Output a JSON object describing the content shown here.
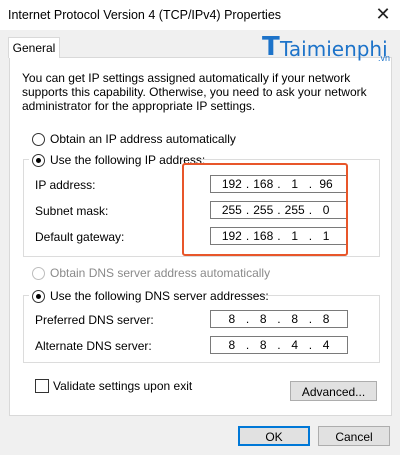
{
  "window": {
    "title": "Internet Protocol Version 4 (TCP/IPv4) Properties",
    "close_glyph": "✕"
  },
  "tabs": [
    {
      "label": "General",
      "active": true
    }
  ],
  "watermark": {
    "brand": "Taimienphi",
    "tld": ".vn"
  },
  "intro_text": "You can get IP settings assigned automatically if your network supports this capability. Otherwise, you need to ask your network administrator for the appropriate IP settings.",
  "ip_section": {
    "auto_label": "Obtain an IP address automatically",
    "auto_selected": false,
    "manual_label": "Use the following IP address:",
    "manual_selected": true,
    "fields": [
      {
        "label": "IP address:",
        "octets": [
          "192",
          "168",
          "1",
          "96"
        ]
      },
      {
        "label": "Subnet mask:",
        "octets": [
          "255",
          "255",
          "255",
          "0"
        ]
      },
      {
        "label": "Default gateway:",
        "octets": [
          "192",
          "168",
          "1",
          "1"
        ]
      }
    ]
  },
  "dns_section": {
    "auto_label": "Obtain DNS server address automatically",
    "auto_enabled": false,
    "manual_label": "Use the following DNS server addresses:",
    "manual_selected": true,
    "fields": [
      {
        "label": "Preferred DNS server:",
        "octets": [
          "8",
          "8",
          "8",
          "8"
        ]
      },
      {
        "label": "Alternate DNS server:",
        "octets": [
          "8",
          "8",
          "4",
          "4"
        ]
      }
    ]
  },
  "validate": {
    "label": "Validate settings upon exit",
    "checked": false
  },
  "buttons": {
    "advanced": "Advanced...",
    "ok": "OK",
    "cancel": "Cancel"
  },
  "colors": {
    "highlight": "#e8562a",
    "brand": "#1d73c9",
    "accent": "#0078d7"
  }
}
